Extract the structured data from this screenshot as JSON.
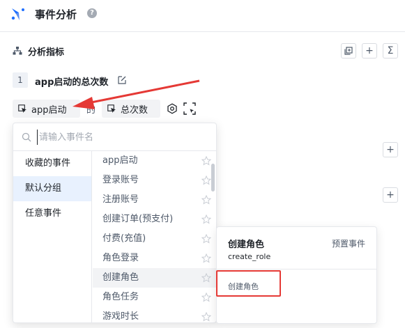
{
  "header": {
    "title": "事件分析",
    "help": "?"
  },
  "section": {
    "title": "分析指标"
  },
  "metric": {
    "index": "1",
    "name": "app启动的总次数",
    "event_label": "app启动",
    "connector": "的",
    "aggregation_label": "总次数"
  },
  "tools": {
    "plus": "+",
    "sum": "Σ"
  },
  "dropdown": {
    "search_placeholder": "请输入事件名",
    "groups": [
      {
        "label": "收藏的事件"
      },
      {
        "label": "默认分组"
      },
      {
        "label": "任意事件"
      }
    ],
    "active_group_index": 1,
    "events": [
      {
        "label": "app启动"
      },
      {
        "label": "登录账号"
      },
      {
        "label": "注册账号"
      },
      {
        "label": "创建订单(预支付)"
      },
      {
        "label": "付费(充值)"
      },
      {
        "label": "角色登录"
      },
      {
        "label": "创建角色"
      },
      {
        "label": "角色任务"
      },
      {
        "label": "游戏时长"
      }
    ],
    "hovered_event_index": 6
  },
  "detail": {
    "title": "创建角色",
    "type": "预置事件",
    "key": "create_role",
    "display_name": "创建角色"
  },
  "colors": {
    "accent": "#1e6fff",
    "annotation_red": "#e53935",
    "active_group_bg": "#e8f1fe"
  }
}
